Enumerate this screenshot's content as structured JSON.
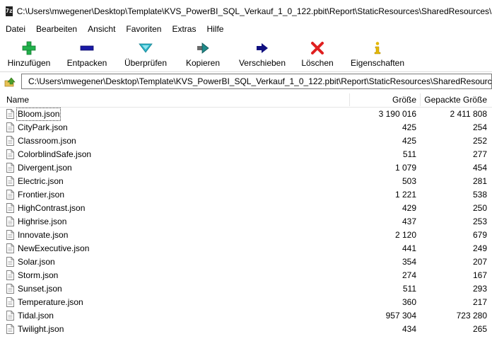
{
  "window": {
    "app_icon_text": "7z",
    "title": "C:\\Users\\mwegener\\Desktop\\Template\\KVS_PowerBI_SQL_Verkauf_1_0_122.pbit\\Report\\StaticResources\\SharedResources\\BuiltInThemes\\"
  },
  "menu": [
    "Datei",
    "Bearbeiten",
    "Ansicht",
    "Favoriten",
    "Extras",
    "Hilfe"
  ],
  "toolbar": [
    {
      "label": "Hinzufügen",
      "icon": "plus-icon",
      "color": "#22b14c"
    },
    {
      "label": "Entpacken",
      "icon": "minus-icon",
      "color": "#1a1aa6"
    },
    {
      "label": "Überprüfen",
      "icon": "check-icon",
      "color": "#2bb3c6"
    },
    {
      "label": "Kopieren",
      "icon": "copy-arrow-icon",
      "color": "#1f8a8a"
    },
    {
      "label": "Verschieben",
      "icon": "move-arrow-icon",
      "color": "#101080"
    },
    {
      "label": "Löschen",
      "icon": "delete-x-icon",
      "color": "#e02020"
    },
    {
      "label": "Eigenschaften",
      "icon": "info-icon",
      "color": "#e5b800"
    }
  ],
  "address": {
    "path": "C:\\Users\\mwegener\\Desktop\\Template\\KVS_PowerBI_SQL_Verkauf_1_0_122.pbit\\Report\\StaticResources\\SharedResources\\BuiltInThemes\\"
  },
  "columns": {
    "name": "Name",
    "size": "Größe",
    "packed": "Gepackte Größe"
  },
  "files": [
    {
      "name": "Bloom.json",
      "size": "3 190 016",
      "packed": "2 411 808"
    },
    {
      "name": "CityPark.json",
      "size": "425",
      "packed": "254"
    },
    {
      "name": "Classroom.json",
      "size": "425",
      "packed": "252"
    },
    {
      "name": "ColorblindSafe.json",
      "size": "511",
      "packed": "277"
    },
    {
      "name": "Divergent.json",
      "size": "1 079",
      "packed": "454"
    },
    {
      "name": "Electric.json",
      "size": "503",
      "packed": "281"
    },
    {
      "name": "Frontier.json",
      "size": "1 221",
      "packed": "538"
    },
    {
      "name": "HighContrast.json",
      "size": "429",
      "packed": "250"
    },
    {
      "name": "Highrise.json",
      "size": "437",
      "packed": "253"
    },
    {
      "name": "Innovate.json",
      "size": "2 120",
      "packed": "679"
    },
    {
      "name": "NewExecutive.json",
      "size": "441",
      "packed": "249"
    },
    {
      "name": "Solar.json",
      "size": "354",
      "packed": "207"
    },
    {
      "name": "Storm.json",
      "size": "274",
      "packed": "167"
    },
    {
      "name": "Sunset.json",
      "size": "511",
      "packed": "293"
    },
    {
      "name": "Temperature.json",
      "size": "360",
      "packed": "217"
    },
    {
      "name": "Tidal.json",
      "size": "957 304",
      "packed": "723 280"
    },
    {
      "name": "Twilight.json",
      "size": "434",
      "packed": "265"
    }
  ]
}
